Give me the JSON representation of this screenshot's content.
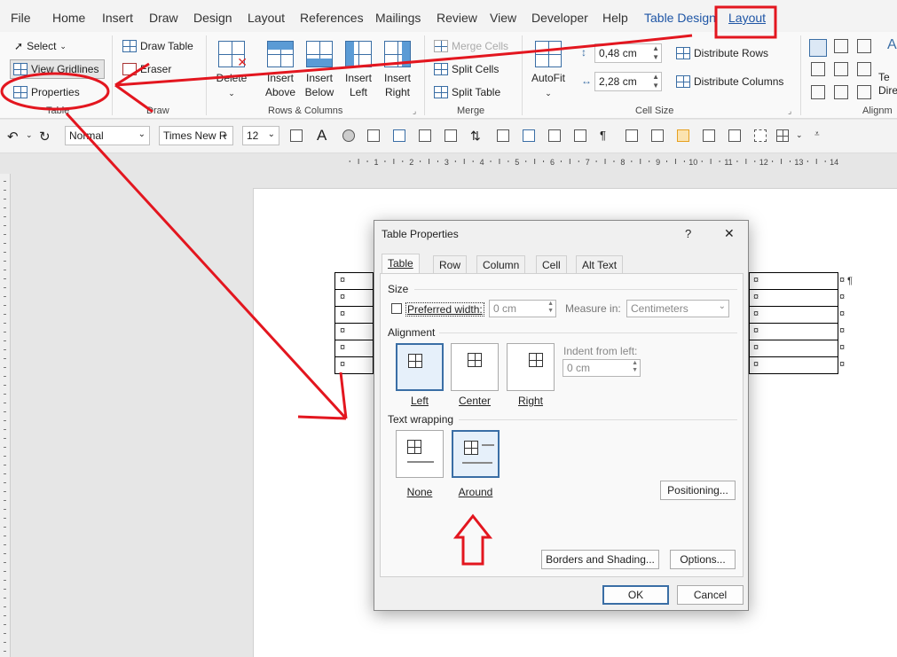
{
  "menubar": {
    "tabs": [
      "File",
      "Home",
      "Insert",
      "Draw",
      "Design",
      "Layout",
      "References",
      "Mailings",
      "Review",
      "View",
      "Developer",
      "Help"
    ],
    "context_tab": "Table Design",
    "active_tab": "Layout"
  },
  "ribbon": {
    "table": {
      "select": "Select",
      "view_gridlines": "View Gridlines",
      "properties": "Properties",
      "label": "Table"
    },
    "draw": {
      "draw_table": "Draw Table",
      "eraser": "Eraser",
      "label": "Draw"
    },
    "rows_cols": {
      "delete": "Delete",
      "insert_above": [
        "Insert",
        "Above"
      ],
      "insert_below": [
        "Insert",
        "Below"
      ],
      "insert_left": [
        "Insert",
        "Left"
      ],
      "insert_right": [
        "Insert",
        "Right"
      ],
      "label": "Rows & Columns"
    },
    "merge": {
      "merge_cells": "Merge Cells",
      "split_cells": "Split Cells",
      "split_table": "Split Table",
      "label": "Merge"
    },
    "cell_size": {
      "autofit": "AutoFit",
      "height": "0,48 cm",
      "width": "2,28 cm",
      "distribute_rows": "Distribute Rows",
      "distribute_columns": "Distribute Columns",
      "label": "Cell Size"
    },
    "alignment": {
      "text_direction": [
        "Te",
        "Dire"
      ],
      "label": "Alignm"
    }
  },
  "quickbar": {
    "style": "Normal",
    "font": "Times New R",
    "size": "12"
  },
  "ruler": {
    "numbers": [
      "1",
      "2",
      "3",
      "4",
      "5",
      "6",
      "7",
      "8",
      "9",
      "10",
      "11",
      "12",
      "13",
      "14"
    ]
  },
  "document": {
    "cell_mark": "¤",
    "para_mark": "¶"
  },
  "dialog": {
    "title": "Table Properties",
    "help": "?",
    "close": "✕",
    "tabs": [
      "Table",
      "Row",
      "Column",
      "Cell",
      "Alt Text"
    ],
    "size": {
      "heading": "Size",
      "preferred_width_label": "Preferred width:",
      "preferred_width_value": "0 cm",
      "measure_in_label": "Measure in:",
      "measure_in_value": "Centimeters"
    },
    "alignment": {
      "heading": "Alignment",
      "options": [
        "Left",
        "Center",
        "Right"
      ],
      "indent_label": "Indent from left:",
      "indent_value": "0 cm"
    },
    "wrapping": {
      "heading": "Text wrapping",
      "options": [
        "None",
        "Around"
      ]
    },
    "buttons": {
      "positioning": "Positioning...",
      "borders": "Borders and Shading...",
      "options": "Options...",
      "ok": "OK",
      "cancel": "Cancel"
    }
  },
  "colors": {
    "annotation": "#e3161f",
    "accent": "#3a6ea5"
  }
}
